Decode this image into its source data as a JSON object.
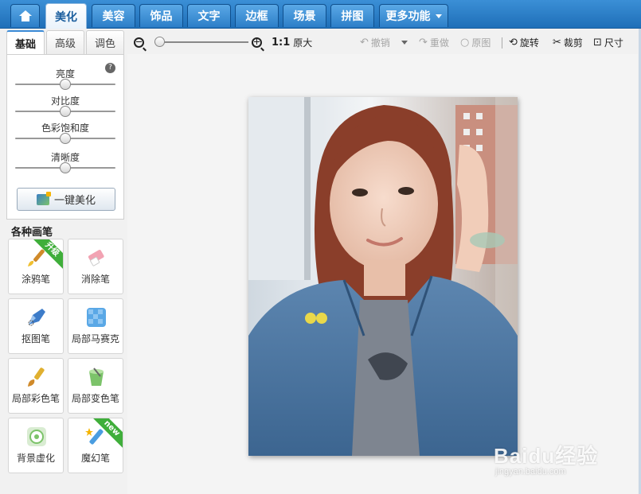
{
  "nav": {
    "tabs": [
      {
        "label": ""
      },
      {
        "label": "美化"
      },
      {
        "label": "美容"
      },
      {
        "label": "饰品"
      },
      {
        "label": "文字"
      },
      {
        "label": "边框"
      },
      {
        "label": "场景"
      },
      {
        "label": "拼图"
      },
      {
        "label": "更多功能"
      }
    ],
    "active": "美化"
  },
  "left": {
    "subtabs": [
      "基础",
      "高级",
      "调色"
    ],
    "sliders": [
      {
        "label": "亮度",
        "value": 0.5
      },
      {
        "label": "对比度",
        "value": 0.5
      },
      {
        "label": "色彩饱和度",
        "value": 0.5
      },
      {
        "label": "清晰度",
        "value": 0.5
      }
    ],
    "onekey_label": "一键美化",
    "brush_title": "各种画笔",
    "brushes": [
      {
        "label": "涂鸦笔",
        "badge": "升级"
      },
      {
        "label": "消除笔",
        "badge": ""
      },
      {
        "label": "抠图笔",
        "badge": ""
      },
      {
        "label": "局部马赛克",
        "badge": ""
      },
      {
        "label": "局部彩色笔",
        "badge": ""
      },
      {
        "label": "局部变色笔",
        "badge": ""
      },
      {
        "label": "背景虚化",
        "badge": ""
      },
      {
        "label": "魔幻笔",
        "badge": "new"
      }
    ]
  },
  "toolbar": {
    "ratio": "1:1",
    "original_size": "原大",
    "undo": "撤销",
    "redo": "重做",
    "original": "原图",
    "rotate": "旋转",
    "crop": "裁剪",
    "size": "尺寸",
    "zoom_value": 0.05
  },
  "watermark": {
    "main": "Baidu经验",
    "sub": "jingyan.baidu.com"
  },
  "colors": {
    "nav_blue": "#2d7fc8",
    "badge_green": "#3fae3a"
  }
}
